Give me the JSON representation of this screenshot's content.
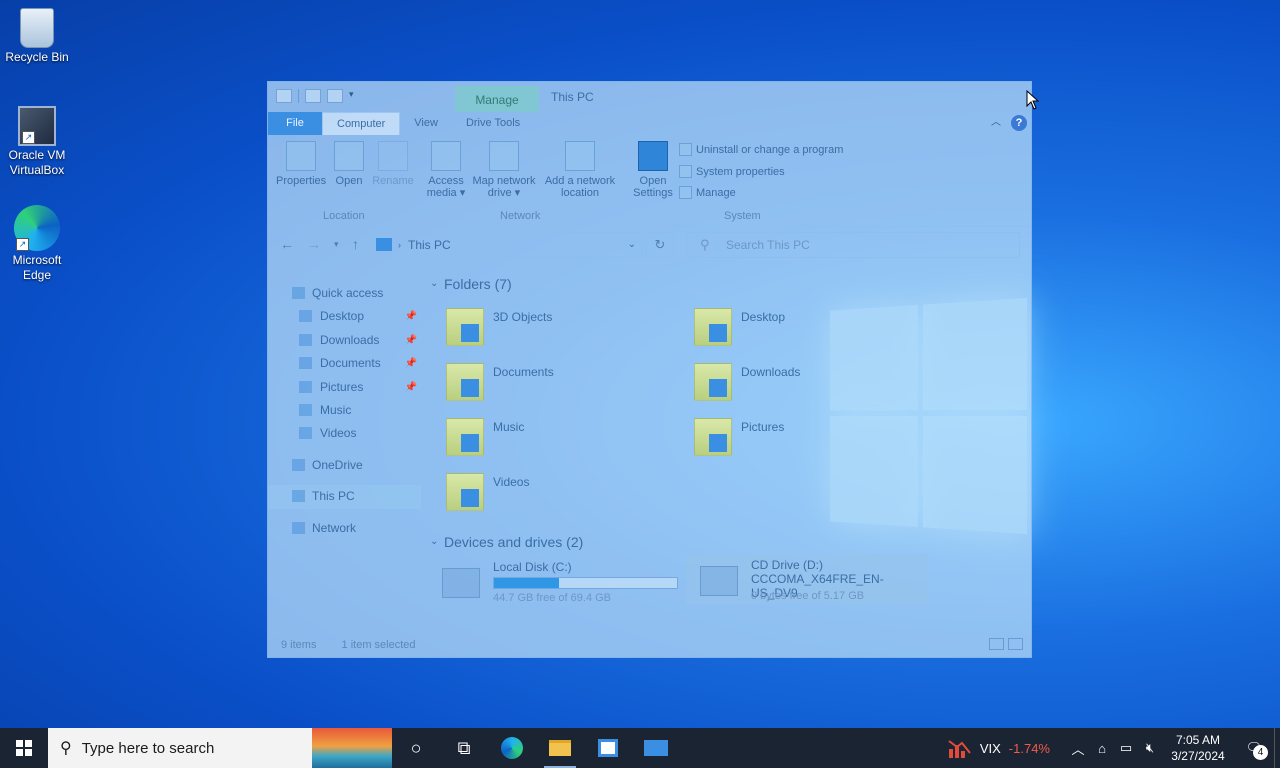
{
  "desktop": {
    "icons": [
      {
        "label": "Recycle Bin"
      },
      {
        "label": "Oracle VM VirtualBox"
      },
      {
        "label": "Microsoft Edge"
      }
    ]
  },
  "explorer": {
    "title": "This PC",
    "context_tab": "Manage",
    "tabs": [
      "File",
      "Computer",
      "View",
      "Drive Tools"
    ],
    "help_glyph": "?",
    "ribbon": {
      "location": {
        "label": "Location",
        "buttons": [
          "Properties",
          "Open",
          "Rename"
        ]
      },
      "network": {
        "label": "Network",
        "buttons": [
          "Access media",
          "Map network drive",
          "Add a network location"
        ]
      },
      "system": {
        "label": "System",
        "open_settings": "Open Settings",
        "commands": [
          "Uninstall or change a program",
          "System properties",
          "Manage"
        ]
      }
    },
    "address": {
      "path": "This PC",
      "search_placeholder": "Search This PC"
    },
    "nav": {
      "quick_access": "Quick access",
      "quick_items": [
        "Desktop",
        "Downloads",
        "Documents",
        "Pictures",
        "Music",
        "Videos"
      ],
      "onedrive": "OneDrive",
      "this_pc": "This PC",
      "network": "Network"
    },
    "folders_header": "Folders (7)",
    "folders": [
      "3D Objects",
      "Desktop",
      "Documents",
      "Downloads",
      "Music",
      "Pictures",
      "Videos"
    ],
    "drives_header": "Devices and drives (2)",
    "drives": [
      {
        "name": "Local Disk (C:)",
        "free_text": "44.7 GB free of 69.4 GB",
        "used_fraction": 0.356
      },
      {
        "name": "CD Drive (D:)",
        "label": "CCCOMA_X64FRE_EN-US_DV9",
        "free_text": "0 bytes free of 5.17 GB"
      }
    ],
    "status": {
      "items": "9 items",
      "selected": "1 item selected"
    }
  },
  "taskbar": {
    "search_placeholder": "Type here to search",
    "vix_label": "VIX",
    "vix_change": "-1.74%",
    "vix_change_color": "#f25a4a",
    "time": "7:05 AM",
    "date": "3/27/2024",
    "notification_count": "4"
  }
}
